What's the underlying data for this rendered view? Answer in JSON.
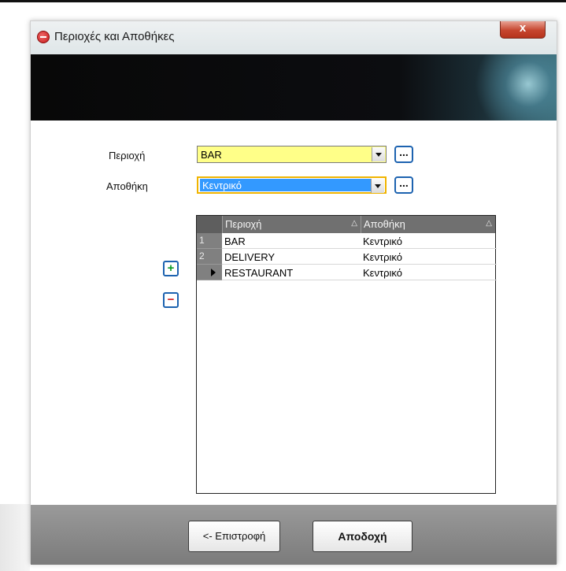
{
  "window": {
    "title": "Περιοχές και Αποθήκες",
    "close_glyph": "x"
  },
  "form": {
    "area_label": "Περιοχή",
    "area_value": "BAR",
    "warehouse_label": "Αποθήκη",
    "warehouse_value": "Κεντρικό",
    "lookup_glyph": "..."
  },
  "grid": {
    "columns": [
      {
        "label": "Περιοχή",
        "sort": "△"
      },
      {
        "label": "Αποθήκη",
        "sort": "△"
      }
    ],
    "rows": [
      {
        "num": "1",
        "area": "BAR",
        "warehouse": "Κεντρικό",
        "current": false
      },
      {
        "num": "2",
        "area": "DELIVERY",
        "warehouse": "Κεντρικό",
        "current": false
      },
      {
        "num": "",
        "area": "RESTAURANT",
        "warehouse": "Κεντρικό",
        "current": true
      }
    ]
  },
  "actions": {
    "add_glyph": "+",
    "remove_glyph": "−"
  },
  "footer": {
    "back_label": "<- Επιστροφή",
    "accept_label": "Αποδοχή"
  },
  "colors": {
    "combo_highlight": "#ffff88",
    "selection_blue": "#3399ff",
    "grid_header": "#707070",
    "footer_gray": "#8a8a8a",
    "close_red": "#c6452e"
  }
}
